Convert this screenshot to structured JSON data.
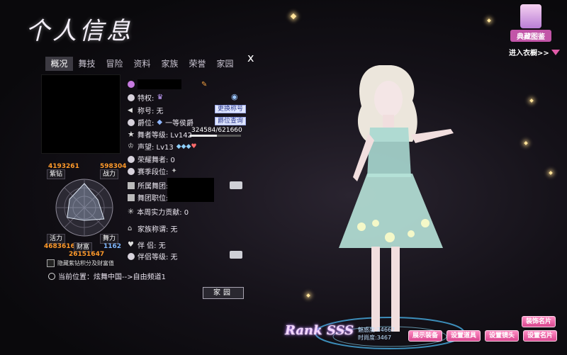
{
  "header": {
    "title": "个人信息",
    "close_label": "x"
  },
  "tabs": [
    "概况",
    "舞技",
    "冒险",
    "资料",
    "家族",
    "荣誉",
    "家园"
  ],
  "stats": {
    "purple_diamond": {
      "label": "紫钻",
      "value": "4193261"
    },
    "combat": {
      "label": "战力",
      "value": "598304"
    },
    "vitality": {
      "label": "活力",
      "value": "4683616"
    },
    "dance": {
      "label": "舞力",
      "value": "1162"
    },
    "wealth": {
      "label": "财富",
      "value": "26151647"
    },
    "radar_levels": [
      0.85,
      0.55,
      0.8,
      0.45,
      0.7,
      0.6
    ]
  },
  "hide_checkbox_label": "隐藏紫钻积分及财富值",
  "location": "当前位置：炫舞中国-->自由频道1",
  "info": {
    "privilege": "特权:",
    "nickname": "称号: 无",
    "change_title_btn": "更换称号",
    "rank_title": "爵位:",
    "rank_value": "一等侯爵",
    "rank_query_btn": "爵位查询",
    "dancer_level": "舞者等级: Lv142",
    "exp": "324584/621660",
    "exp_fraction": 0.522,
    "fame": "声望: Lv13",
    "glory_dancer": "荣耀舞者: 0",
    "season_rank": "赛季段位:",
    "dance_group": "所属舞团:",
    "group_position": "舞团职位:",
    "weekly_contrib": "本周实力贡献: 0",
    "family_title": "家族称谓: 无",
    "partner": "伴    侣: 无",
    "partner_level": "伴侣等级: 无",
    "home_btn": "家园"
  },
  "right": {
    "collection_label": "典藏图鉴",
    "wardrobe_label": "进入衣橱>>"
  },
  "bottom": {
    "rank": "Rank SSS",
    "score1": "魅惑度:24667",
    "score2": "时尚度:3467",
    "buttons": [
      "展示装备",
      "设置道具",
      "设置镜头",
      "设置名片"
    ],
    "card_btn": "装饰名片"
  },
  "colors": {
    "accent_pink": "#d9468f",
    "stat_orange": "#ff9a2a",
    "stat_blue": "#7fb8ff"
  }
}
